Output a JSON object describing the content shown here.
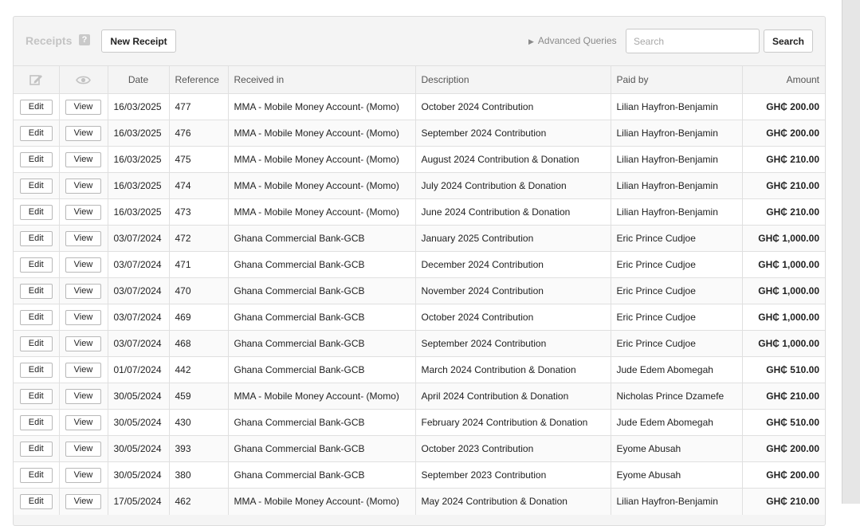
{
  "toolbar": {
    "title": "Receipts",
    "help_icon_glyph": "?",
    "new_receipt_label": "New Receipt",
    "advanced_queries_label": "Advanced Queries",
    "search_placeholder": "Search",
    "search_value": "",
    "search_button_label": "Search"
  },
  "table": {
    "columns": {
      "edit_icon": "edit-icon",
      "view_icon": "eye-icon",
      "date": "Date",
      "reference": "Reference",
      "received_in": "Received in",
      "description": "Description",
      "paid_by": "Paid by",
      "amount": "Amount"
    },
    "edit_label": "Edit",
    "view_label": "View",
    "rows": [
      {
        "date": "16/03/2025",
        "reference": "477",
        "received_in": "MMA - Mobile Money Account- (Momo)",
        "description": "October 2024 Contribution",
        "paid_by": "Lilian Hayfron-Benjamin",
        "amount": "GH₵ 200.00"
      },
      {
        "date": "16/03/2025",
        "reference": "476",
        "received_in": "MMA - Mobile Money Account- (Momo)",
        "description": "September 2024 Contribution",
        "paid_by": "Lilian Hayfron-Benjamin",
        "amount": "GH₵ 200.00"
      },
      {
        "date": "16/03/2025",
        "reference": "475",
        "received_in": "MMA - Mobile Money Account- (Momo)",
        "description": "August 2024 Contribution & Donation",
        "paid_by": "Lilian Hayfron-Benjamin",
        "amount": "GH₵ 210.00"
      },
      {
        "date": "16/03/2025",
        "reference": "474",
        "received_in": "MMA - Mobile Money Account- (Momo)",
        "description": "July 2024 Contribution & Donation",
        "paid_by": "Lilian Hayfron-Benjamin",
        "amount": "GH₵ 210.00"
      },
      {
        "date": "16/03/2025",
        "reference": "473",
        "received_in": "MMA - Mobile Money Account- (Momo)",
        "description": "June 2024 Contribution & Donation",
        "paid_by": "Lilian Hayfron-Benjamin",
        "amount": "GH₵ 210.00"
      },
      {
        "date": "03/07/2024",
        "reference": "472",
        "received_in": "Ghana Commercial Bank-GCB",
        "description": "January 2025 Contribution",
        "paid_by": "Eric Prince Cudjoe",
        "amount": "GH₵ 1,000.00"
      },
      {
        "date": "03/07/2024",
        "reference": "471",
        "received_in": "Ghana Commercial Bank-GCB",
        "description": "December 2024 Contribution",
        "paid_by": "Eric Prince Cudjoe",
        "amount": "GH₵ 1,000.00"
      },
      {
        "date": "03/07/2024",
        "reference": "470",
        "received_in": "Ghana Commercial Bank-GCB",
        "description": "November 2024 Contribution",
        "paid_by": "Eric Prince Cudjoe",
        "amount": "GH₵ 1,000.00"
      },
      {
        "date": "03/07/2024",
        "reference": "469",
        "received_in": "Ghana Commercial Bank-GCB",
        "description": "October 2024 Contribution",
        "paid_by": "Eric Prince Cudjoe",
        "amount": "GH₵ 1,000.00"
      },
      {
        "date": "03/07/2024",
        "reference": "468",
        "received_in": "Ghana Commercial Bank-GCB",
        "description": "September 2024 Contribution",
        "paid_by": "Eric Prince Cudjoe",
        "amount": "GH₵ 1,000.00"
      },
      {
        "date": "01/07/2024",
        "reference": "442",
        "received_in": "Ghana Commercial Bank-GCB",
        "description": "March 2024 Contribution & Donation",
        "paid_by": "Jude Edem Abomegah",
        "amount": "GH₵ 510.00"
      },
      {
        "date": "30/05/2024",
        "reference": "459",
        "received_in": "MMA - Mobile Money Account- (Momo)",
        "description": "April 2024 Contribution & Donation",
        "paid_by": "Nicholas Prince Dzamefe",
        "amount": "GH₵ 210.00"
      },
      {
        "date": "30/05/2024",
        "reference": "430",
        "received_in": "Ghana Commercial Bank-GCB",
        "description": "February 2024 Contribution & Donation",
        "paid_by": "Jude Edem Abomegah",
        "amount": "GH₵ 510.00"
      },
      {
        "date": "30/05/2024",
        "reference": "393",
        "received_in": "Ghana Commercial Bank-GCB",
        "description": "October 2023 Contribution",
        "paid_by": "Eyome Abusah",
        "amount": "GH₵ 200.00"
      },
      {
        "date": "30/05/2024",
        "reference": "380",
        "received_in": "Ghana Commercial Bank-GCB",
        "description": "September 2023 Contribution",
        "paid_by": "Eyome Abusah",
        "amount": "GH₵ 200.00"
      },
      {
        "date": "17/05/2024",
        "reference": "462",
        "received_in": "MMA - Mobile Money Account- (Momo)",
        "description": "May 2024 Contribution & Donation",
        "paid_by": "Lilian Hayfron-Benjamin",
        "amount": "GH₵ 210.00"
      }
    ]
  }
}
